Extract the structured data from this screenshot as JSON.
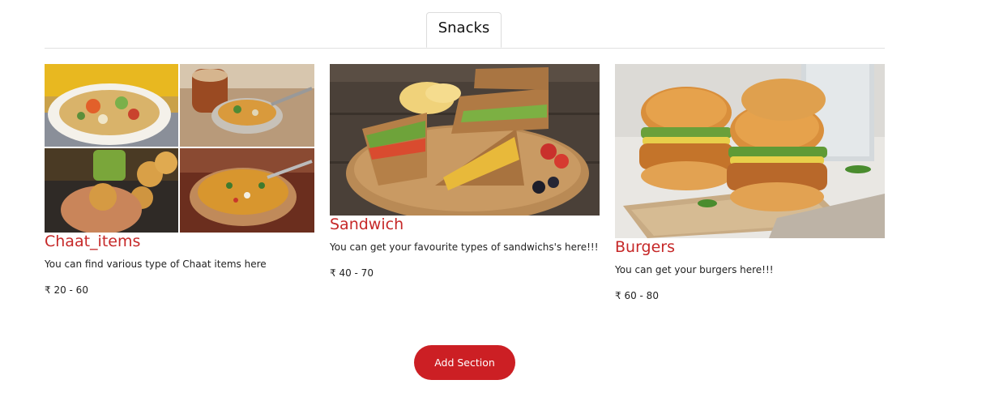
{
  "tabs": {
    "active_label": "Snacks"
  },
  "items": [
    {
      "name": "Chaat_items",
      "description": "You can find various type of Chaat items here",
      "price": "₹ 20 - 60",
      "image": "chaat-collage-photo"
    },
    {
      "name": "Sandwich",
      "description": "You can get your favourite types of sandwichs's here!!!",
      "price": "₹ 40 - 70",
      "image": "sandwich-photo"
    },
    {
      "name": "Burgers",
      "description": "You can get your burgers here!!!",
      "price": "₹ 60 - 80",
      "image": "burgers-photo"
    }
  ],
  "actions": {
    "add_section_label": "Add Section"
  },
  "colors": {
    "accent": "#cc1f24",
    "title": "#c62828"
  }
}
